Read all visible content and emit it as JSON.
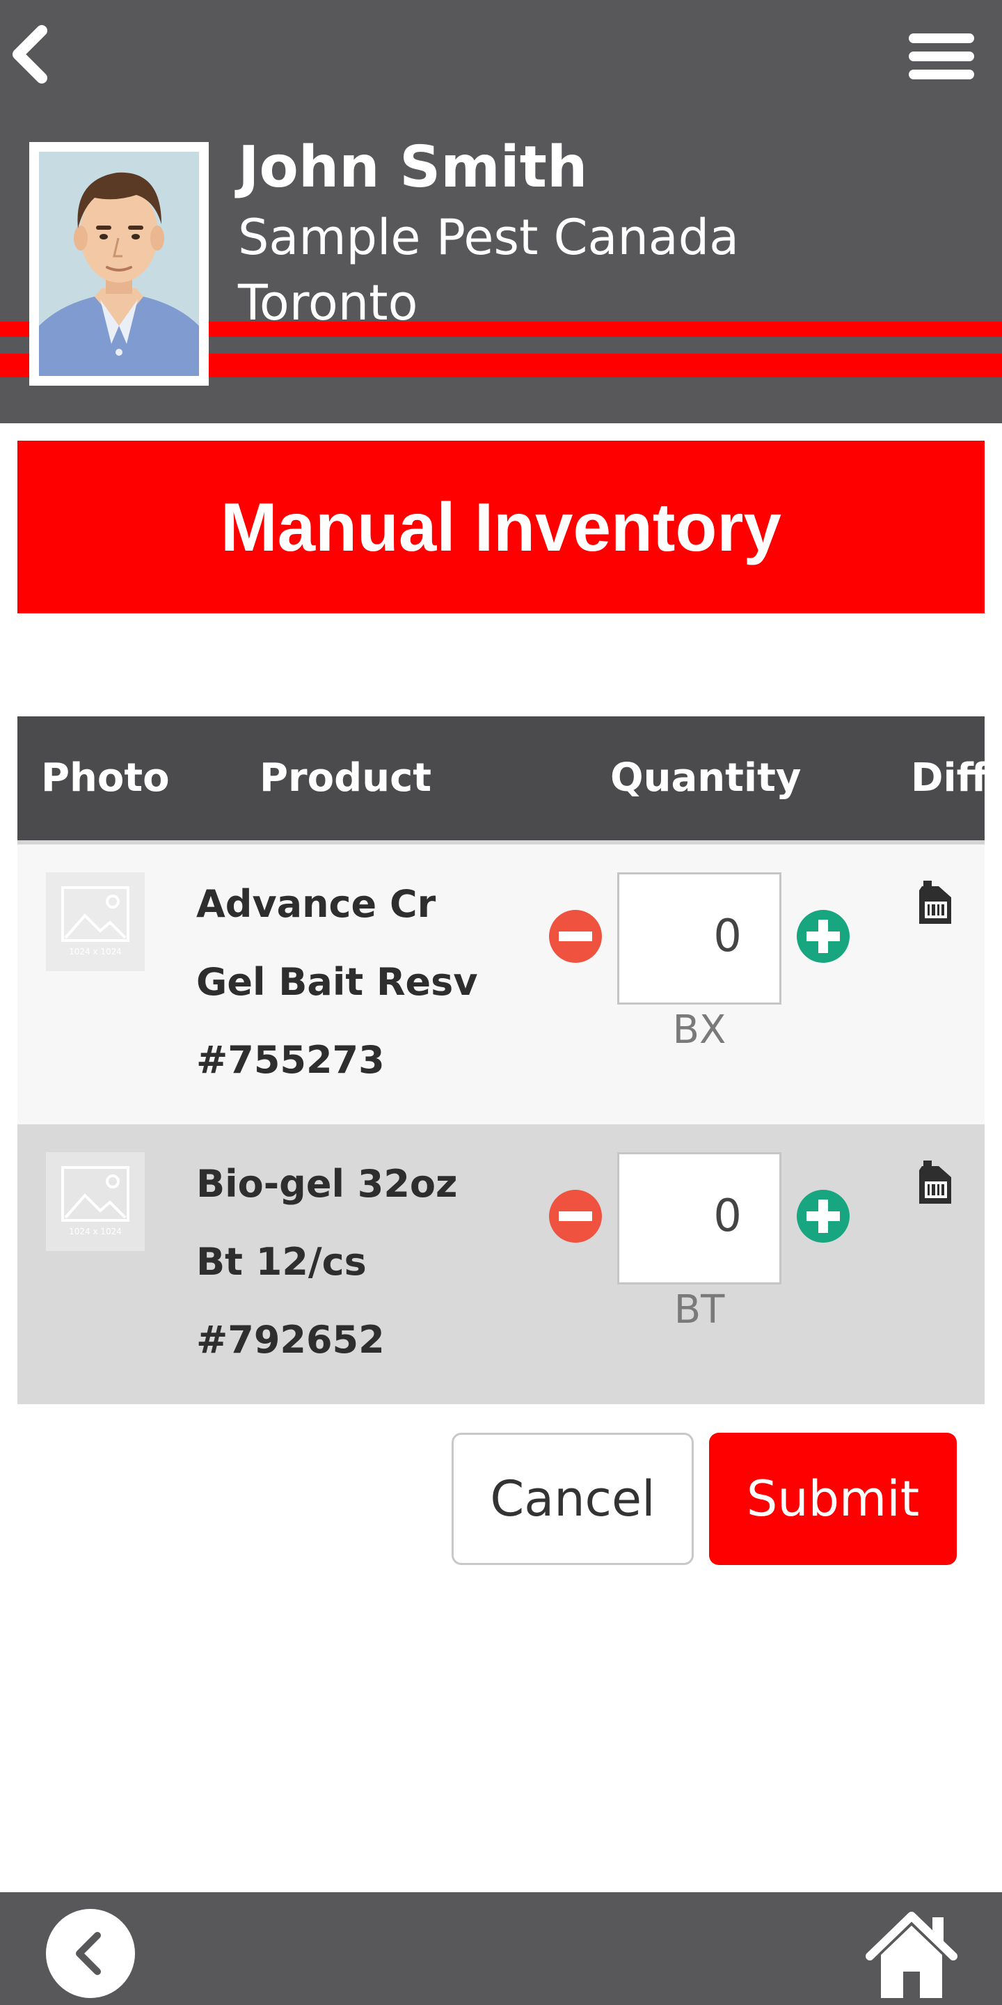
{
  "header": {
    "back_icon": "chevron-left-icon",
    "menu_icon": "hamburger-menu-icon",
    "user": {
      "name": "John Smith",
      "company": "Sample Pest Canada",
      "city": "Toronto"
    }
  },
  "page_title": "Manual Inventory",
  "table": {
    "columns": [
      "Photo",
      "Product",
      "Quantity",
      "Diff"
    ],
    "rows": [
      {
        "name_lines": [
          "Advance Cr",
          "Gel Bait Resv",
          "#755273"
        ],
        "quantity": "0",
        "unit": "BX",
        "thumb_label": "1024 x 1024"
      },
      {
        "name_lines": [
          "Bio-gel 32oz",
          "Bt 12/cs",
          "#792652"
        ],
        "quantity": "0",
        "unit": "BT",
        "thumb_label": "1024 x 1024"
      }
    ]
  },
  "actions": {
    "cancel_label": "Cancel",
    "submit_label": "Submit"
  },
  "footer": {
    "back_icon": "chevron-left-icon",
    "home_icon": "home-icon"
  },
  "colors": {
    "header_bg": "#58575a",
    "accent": "#ff0000",
    "table_header_bg": "#4b4b4d",
    "minus": "#ef5340",
    "plus": "#17a67f"
  }
}
